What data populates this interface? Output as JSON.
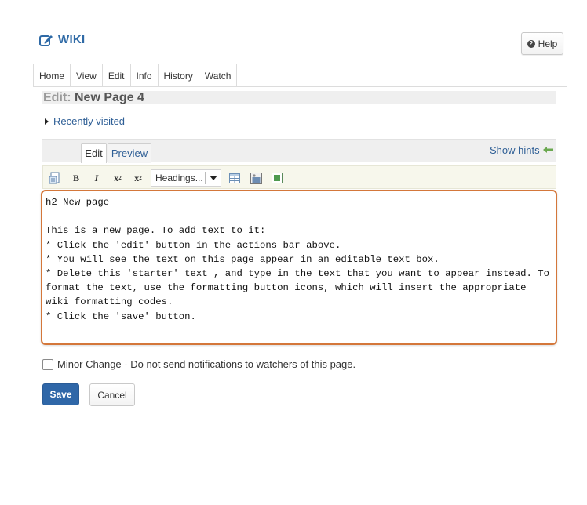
{
  "header": {
    "title": "WIKI",
    "help_label": "Help"
  },
  "tool_tabs": [
    {
      "label": "Home"
    },
    {
      "label": "View"
    },
    {
      "label": "Edit"
    },
    {
      "label": "Info"
    },
    {
      "label": "History"
    },
    {
      "label": "Watch"
    }
  ],
  "page": {
    "edit_prefix": "Edit:",
    "page_name": "New Page 4",
    "recently_visited": "Recently visited"
  },
  "editor": {
    "tabs": {
      "edit": "Edit",
      "preview": "Preview"
    },
    "show_hints": "Show hints",
    "toolbar": {
      "bold": "B",
      "italic": "I",
      "superscript": "x",
      "subscript": "x",
      "headings_select": "Headings...",
      "icons": [
        "document-icon",
        "bold-icon",
        "italic-icon",
        "superscript-icon",
        "subscript-icon",
        "table-icon",
        "image-icon",
        "embed-icon"
      ]
    },
    "content": "h2 New page\n\nThis is a new page. To add text to it:\n* Click the 'edit' button in the actions bar above.\n* You will see the text on this page appear in an editable text box.\n* Delete this 'starter' text , and type in the text that you want to appear instead. To\nformat the text, use the formatting button icons, which will insert the appropriate\nwiki formatting codes.\n* Click the 'save' button.",
    "highlight_color": "#d4773a"
  },
  "form": {
    "minor_change_label": "Minor Change - Do not send notifications to watchers of this page.",
    "minor_change_checked": false,
    "save_label": "Save",
    "cancel_label": "Cancel"
  },
  "colors": {
    "link": "#2f5f96",
    "primary_button": "#2f67a8"
  }
}
